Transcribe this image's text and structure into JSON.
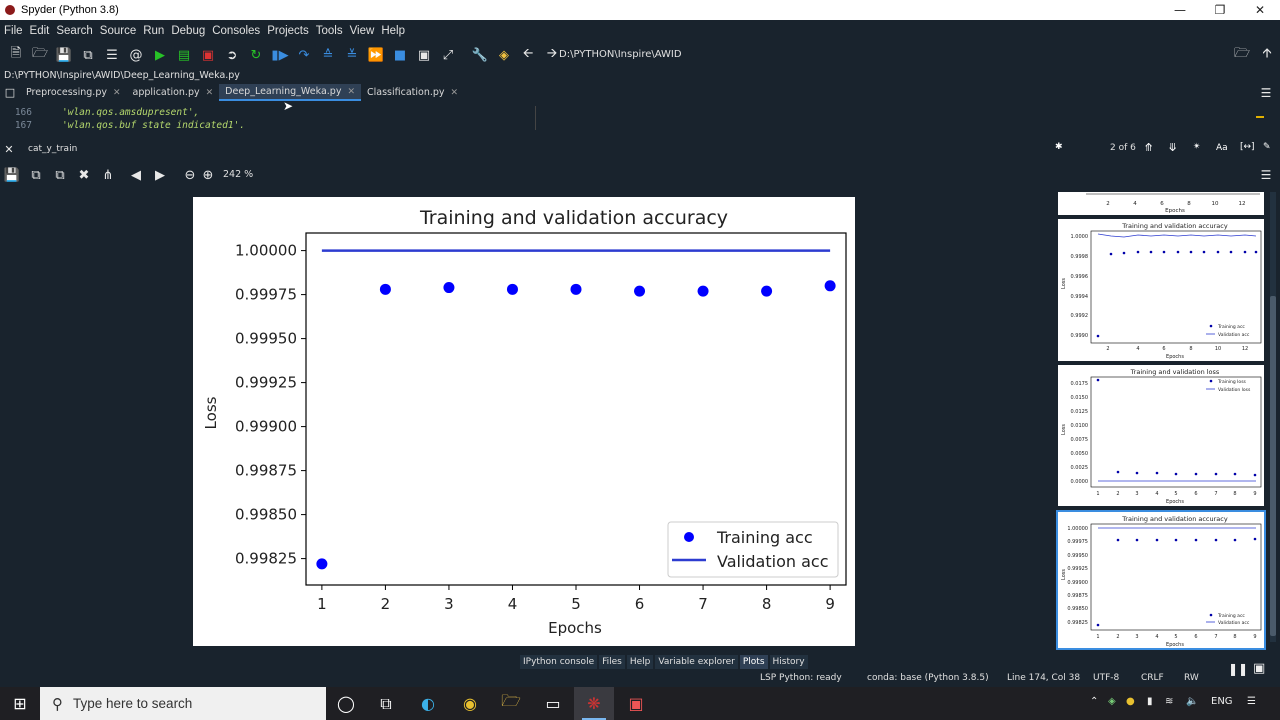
{
  "window": {
    "title": "Spyder (Python 3.8)"
  },
  "menu": [
    "File",
    "Edit",
    "Search",
    "Source",
    "Run",
    "Debug",
    "Consoles",
    "Projects",
    "Tools",
    "View",
    "Help"
  ],
  "toolbar": {
    "path": "D:\\PYTHON\\Inspire\\AWID"
  },
  "editor": {
    "file_path": "D:\\PYTHON\\Inspire\\AWID\\Deep_Learning_Weka.py",
    "tabs": [
      {
        "label": "Preprocessing.py",
        "active": false
      },
      {
        "label": "application.py",
        "active": false
      },
      {
        "label": "Deep_Learning_Weka.py",
        "active": true
      },
      {
        "label": "Classification.py",
        "active": false
      }
    ],
    "lines": [
      {
        "num": "166",
        "text": "'wlan.qos.amsdupresent',"
      },
      {
        "num": "167",
        "text": "'wlan.qos.buf state indicated1'."
      }
    ]
  },
  "find": {
    "query": "cat_y_train",
    "count": "2 of 6",
    "case_label": "Aa"
  },
  "plots": {
    "zoom": "242 %"
  },
  "colors": {
    "bg": "#19232d",
    "accent": "#3a8de0",
    "plot_blue": "#0000ff"
  },
  "main_chart": {
    "title": "Training and validation accuracy",
    "xlabel": "Epochs",
    "ylabel": "Loss",
    "yticks": [
      "1.00000",
      "0.99975",
      "0.99950",
      "0.99925",
      "0.99900",
      "0.99875",
      "0.99850",
      "0.99825"
    ],
    "xticks": [
      "1",
      "2",
      "3",
      "4",
      "5",
      "6",
      "7",
      "8",
      "9"
    ],
    "legend": [
      "Training acc",
      "Validation acc"
    ]
  },
  "chart_data": [
    {
      "type": "scatter",
      "title": "Training and validation accuracy",
      "xlabel": "Epochs",
      "ylabel": "Loss",
      "xlim": [
        0.75,
        9.25
      ],
      "ylim": [
        0.9981,
        1.0001
      ],
      "legend_position": "lower-right",
      "series": [
        {
          "name": "Training acc",
          "style": "points",
          "x": [
            1,
            2,
            3,
            4,
            5,
            6,
            7,
            8,
            9
          ],
          "values": [
            0.99822,
            0.99978,
            0.99979,
            0.99978,
            0.99978,
            0.99977,
            0.99977,
            0.99977,
            0.9998
          ]
        },
        {
          "name": "Validation acc",
          "style": "line",
          "x": [
            1,
            2,
            3,
            4,
            5,
            6,
            7,
            8,
            9
          ],
          "values": [
            1.0,
            1.0,
            1.0,
            1.0,
            1.0,
            1.0,
            1.0,
            1.0,
            1.0
          ]
        }
      ]
    }
  ],
  "thumbnails": {
    "top_partial": {
      "xticks": [
        "2",
        "4",
        "6",
        "8",
        "10",
        "12"
      ],
      "xlabel": "Epochs"
    },
    "thumb1": {
      "title": "Training and validation accuracy",
      "ylabel": "Loss",
      "xlabel": "Epochs",
      "yticks": [
        "1.0000",
        "0.9998",
        "0.9996",
        "0.9994",
        "0.9992",
        "0.9990"
      ],
      "xticks": [
        "2",
        "4",
        "6",
        "8",
        "10",
        "12"
      ],
      "legend": [
        "Training acc",
        "Validation acc"
      ]
    },
    "thumb2": {
      "title": "Training and validation loss",
      "ylabel": "Loss",
      "xlabel": "Epochs",
      "yticks": [
        "0.0175",
        "0.0150",
        "0.0125",
        "0.0100",
        "0.0075",
        "0.0050",
        "0.0025",
        "0.0000"
      ],
      "xticks": [
        "1",
        "2",
        "3",
        "4",
        "5",
        "6",
        "7",
        "8",
        "9"
      ],
      "legend": [
        "Training loss",
        "Validation loss"
      ]
    },
    "thumb3": {
      "title": "Training and validation accuracy",
      "ylabel": "Loss",
      "xlabel": "Epochs",
      "yticks": [
        "1.00000",
        "0.99975",
        "0.99950",
        "0.99925",
        "0.99900",
        "0.99875",
        "0.99850",
        "0.99825"
      ],
      "xticks": [
        "1",
        "2",
        "3",
        "4",
        "5",
        "6",
        "7",
        "8",
        "9"
      ],
      "legend": [
        "Training acc",
        "Validation acc"
      ]
    }
  },
  "pane_tabs": [
    {
      "label": "IPython console",
      "active": false
    },
    {
      "label": "Files",
      "active": false
    },
    {
      "label": "Help",
      "active": false
    },
    {
      "label": "Variable explorer",
      "active": false
    },
    {
      "label": "Plots",
      "active": true
    },
    {
      "label": "History",
      "active": false
    }
  ],
  "status": {
    "lsp": "LSP Python: ready",
    "conda": "conda: base (Python 3.8.5)",
    "position": "Line 174, Col 38",
    "encoding": "UTF-8",
    "eol": "CRLF",
    "mode": "RW"
  },
  "taskbar": {
    "search_placeholder": "Type here to search",
    "language": "ENG"
  }
}
